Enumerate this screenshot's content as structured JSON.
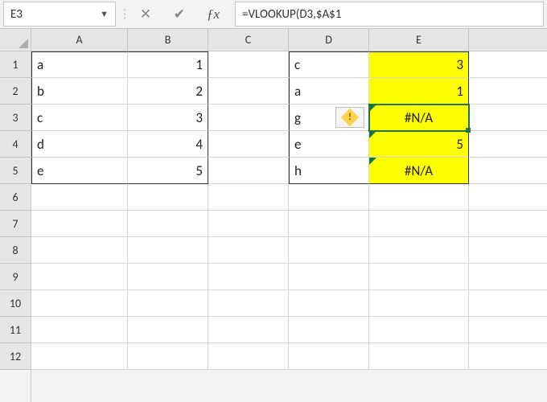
{
  "formula_bar": {
    "name_box": "E3",
    "formula": "=VLOOKUP(D3,$A$1"
  },
  "columns": [
    "A",
    "B",
    "C",
    "D",
    "E"
  ],
  "row_headers": [
    "1",
    "2",
    "3",
    "4",
    "5",
    "6",
    "7",
    "8",
    "9",
    "10",
    "11",
    "12"
  ],
  "cells": {
    "A1": "a",
    "A2": "b",
    "A3": "c",
    "A4": "d",
    "A5": "e",
    "B1": "1",
    "B2": "2",
    "B3": "3",
    "B4": "4",
    "B5": "5",
    "D1": "c",
    "D2": "a",
    "D3": "g",
    "D4": "e",
    "D5": "h",
    "E1": "3",
    "E2": "1",
    "E3": "#N/A",
    "E4": "5",
    "E5": "#N/A"
  },
  "active_cell": "E3",
  "error_badge_text": "!",
  "colors": {
    "highlight": "#ffff00",
    "selection": "#217346"
  }
}
